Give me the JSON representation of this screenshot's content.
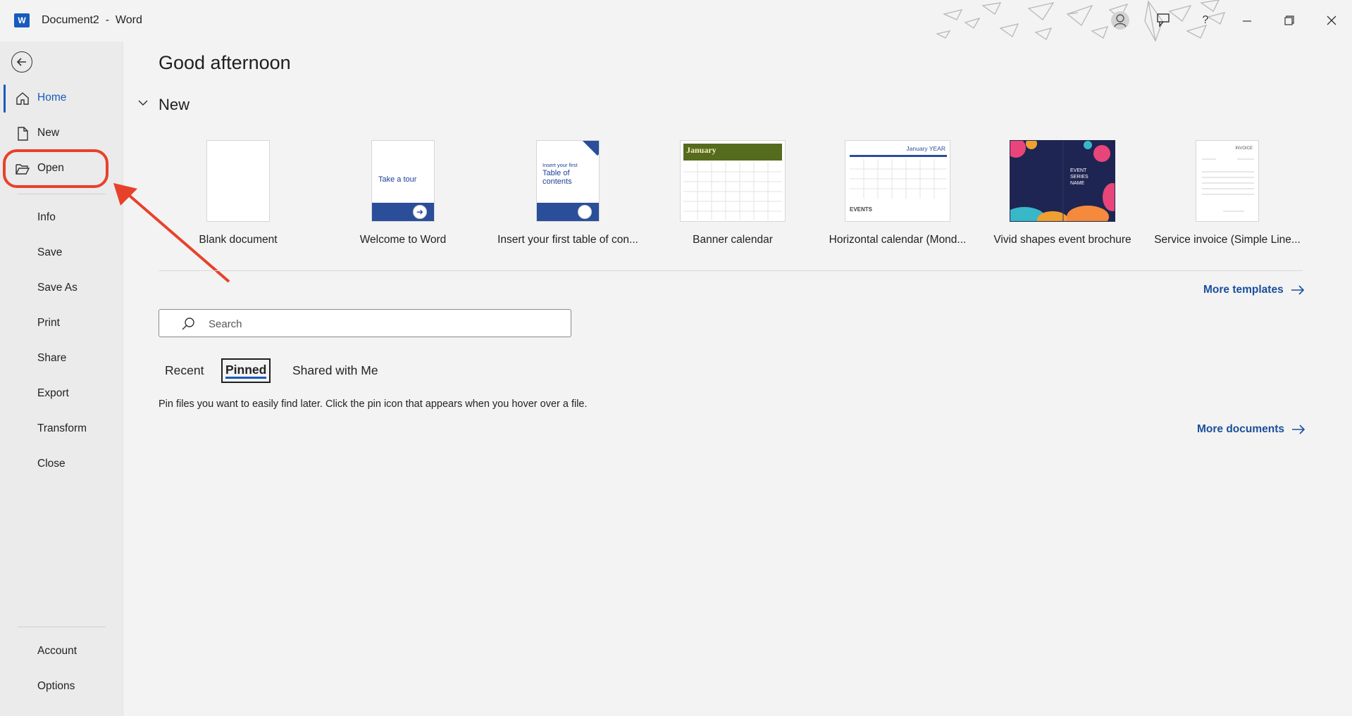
{
  "window": {
    "title": "Document2  -  Word",
    "app_icon": "W"
  },
  "titlebar_icons": [
    "account-icon",
    "feedback-icon",
    "help-icon",
    "minimize-icon",
    "restore-icon",
    "close-icon"
  ],
  "sidebar": {
    "items": [
      {
        "label": "Home",
        "icon": "home-icon",
        "active": true
      },
      {
        "label": "New",
        "icon": "new-document-icon"
      },
      {
        "label": "Open",
        "icon": "open-folder-icon"
      },
      {
        "label": "Info"
      },
      {
        "label": "Save"
      },
      {
        "label": "Save As"
      },
      {
        "label": "Print"
      },
      {
        "label": "Share"
      },
      {
        "label": "Export"
      },
      {
        "label": "Transform"
      },
      {
        "label": "Close"
      }
    ],
    "footer": [
      {
        "label": "Account"
      },
      {
        "label": "Options"
      }
    ]
  },
  "main": {
    "greeting": "Good afternoon",
    "new_section": {
      "title": "New",
      "templates": [
        {
          "name": "Blank document"
        },
        {
          "name": "Welcome to Word",
          "thumb_text": "Take a tour"
        },
        {
          "name": "Insert your first table of con...",
          "thumb_text_small": "Insert your first",
          "thumb_text": "Table of contents"
        },
        {
          "name": "Banner calendar",
          "thumb_text": "January"
        },
        {
          "name": "Horizontal calendar (Mond...",
          "thumb_text": "January YEAR",
          "thumb_text2": "EVENTS"
        },
        {
          "name": "Vivid shapes event brochure",
          "thumb_text": "EVENT SERIES NAME"
        },
        {
          "name": "Service invoice (Simple Line...",
          "thumb_text": "INVOICE"
        }
      ],
      "more_templates": "More templates"
    },
    "search": {
      "placeholder": "Search"
    },
    "tabs": [
      {
        "label": "Recent"
      },
      {
        "label": "Pinned",
        "selected": true
      },
      {
        "label": "Shared with Me"
      }
    ],
    "pinned_hint": "Pin files you want to easily find later. Click the pin icon that appears when you hover over a file.",
    "more_documents": "More documents"
  },
  "colors": {
    "accent": "#185abd",
    "annotation": "#e8412b",
    "link": "#1b4f9c"
  }
}
